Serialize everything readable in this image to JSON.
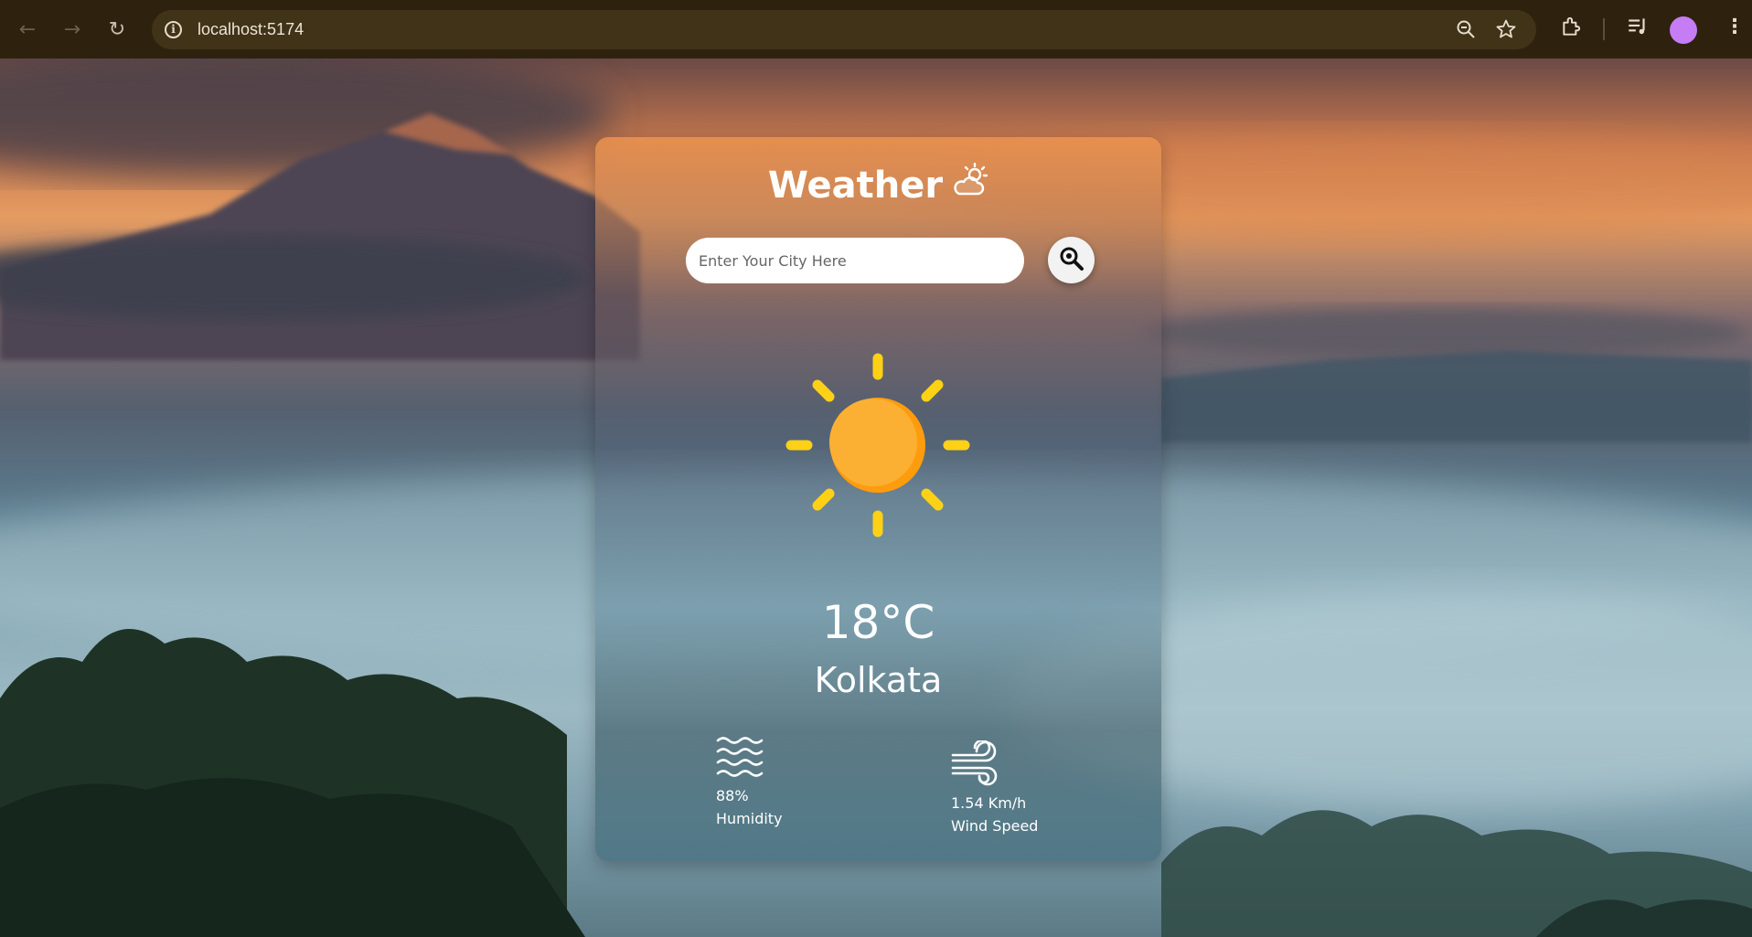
{
  "browser": {
    "url": "localhost:5174"
  },
  "app": {
    "title": "Weather",
    "search": {
      "placeholder": "Enter Your City Here",
      "value": ""
    },
    "weather_icon": "sun-icon",
    "temperature": "18°C",
    "city": "Kolkata",
    "humidity": {
      "value": "88%",
      "label": "Humidity",
      "icon": "waves-icon"
    },
    "wind": {
      "value": "1.54 Km/h",
      "label": "Wind Speed",
      "icon": "wind-icon"
    }
  },
  "colors": {
    "chrome_bg": "#2e220f",
    "omnibox_bg": "#413318",
    "sun_yellow": "#fdd116",
    "sun_orange": "#fbb034",
    "profile": "#c67cf5"
  }
}
